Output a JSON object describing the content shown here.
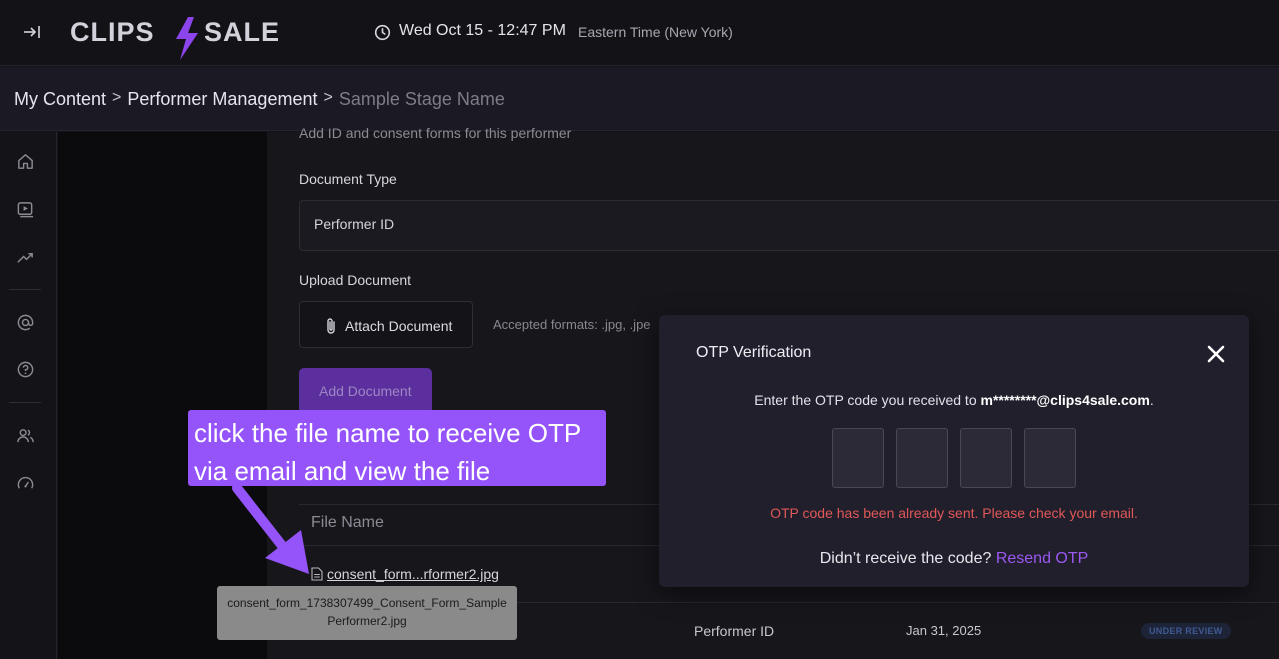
{
  "header": {
    "logo_text": "CLIPS4SALE",
    "datetime": "Wed Oct 15 - 12:47 PM",
    "timezone": "Eastern Time (New York)"
  },
  "breadcrumb": {
    "items": [
      "My Content",
      "Performer Management"
    ],
    "separator": ">",
    "current": "Sample Stage Name"
  },
  "sidebar": {
    "icons": [
      "home-icon",
      "video-icon",
      "trending-icon",
      "at-sign-icon",
      "help-icon",
      "users-icon",
      "gauge-icon"
    ]
  },
  "form": {
    "intro": "Add ID and consent forms for this performer",
    "document_type_label": "Document Type",
    "document_type_value": "Performer ID",
    "upload_label": "Upload Document",
    "attach_label": "Attach Document",
    "formats": "Accepted formats: .jpg, .jpe",
    "add_button": "Add Document"
  },
  "table": {
    "header_filename": "File Name",
    "row1_filename": "consent_form...rformer2.jpg",
    "row2_type": "Performer ID",
    "row2_date": "Jan 31, 2025",
    "row2_status": "UNDER REVIEW",
    "tooltip_line1": "consent_form_1738307499_Consent_Form_Sample",
    "tooltip_line2": "Performer2.jpg"
  },
  "annotation": {
    "text": "click the file name to receive OTP via email and view the file"
  },
  "modal": {
    "title": "OTP Verification",
    "message_prefix": "Enter the OTP code you received to ",
    "email": "m********@clips4sale.com",
    "message_suffix": ".",
    "error": "OTP code has been already sent. Please check your email.",
    "resend_prompt": "Didn’t receive the code? ",
    "resend_link": "Resend OTP"
  },
  "colors": {
    "accent": "#9b58f3",
    "error": "#e05858",
    "callout": "#9554fa"
  }
}
